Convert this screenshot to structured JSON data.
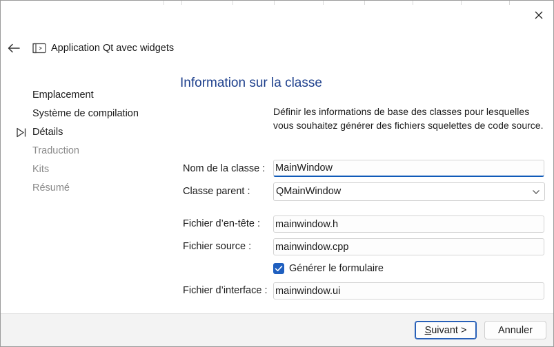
{
  "wizard": {
    "title": "Application Qt avec widgets"
  },
  "steps": [
    {
      "label": "Emplacement",
      "state": "done"
    },
    {
      "label": "Système de compilation",
      "state": "done"
    },
    {
      "label": "Détails",
      "state": "current"
    },
    {
      "label": "Traduction",
      "state": "pending"
    },
    {
      "label": "Kits",
      "state": "pending"
    },
    {
      "label": "Résumé",
      "state": "pending"
    }
  ],
  "page": {
    "title": "Information sur la classe",
    "description": "Définir les informations de base des classes pour lesquelles vous souhaitez générer des fichiers squelettes de code source."
  },
  "form": {
    "class_name_label": "Nom de la classe :",
    "class_name_value": "MainWindow",
    "parent_class_label": "Classe parent :",
    "parent_class_value": "QMainWindow",
    "header_file_label": "Fichier d’en-tête :",
    "header_file_value": "mainwindow.h",
    "source_file_label": "Fichier source :",
    "source_file_value": "mainwindow.cpp",
    "generate_form_label": "Générer le formulaire",
    "generate_form_checked": true,
    "ui_file_label": "Fichier d’interface :",
    "ui_file_value": "mainwindow.ui"
  },
  "footer": {
    "next_mnemonic": "S",
    "next_rest": "uivant >",
    "cancel_label": "Annuler"
  },
  "colors": {
    "title_blue": "#1d3f8c",
    "accent": "#1f5fbf",
    "pending_text": "#8a8a8a"
  },
  "icons": {
    "close": "close-icon",
    "back": "back-arrow-icon",
    "wizard": "window-icon",
    "current_step": "current-step-marker-icon",
    "dropdown": "chevron-down-icon",
    "check": "check-icon"
  }
}
